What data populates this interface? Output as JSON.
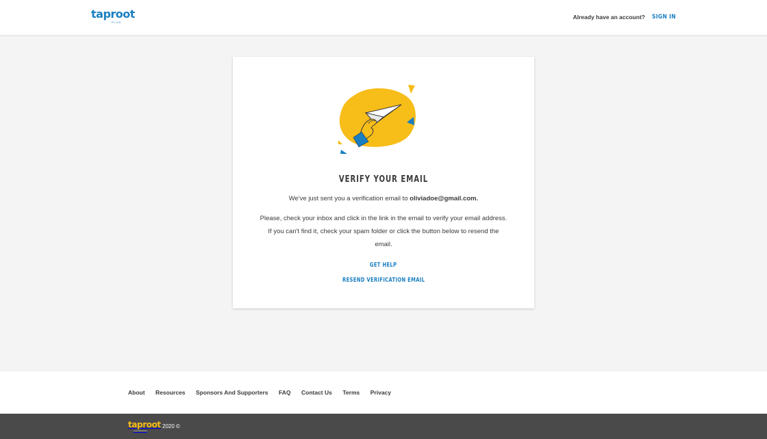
{
  "header": {
    "logo_text": "taproot",
    "logo_sub": "PLUS",
    "account_prompt": "Already have an account?",
    "sign_in_label": "SIGN IN"
  },
  "card": {
    "title": "VERIFY YOUR EMAIL",
    "sent_prefix": "We've just sent you a verification email to",
    "email": "oliviadoe@gmail.com.",
    "instructions": "Please, check your inbox and click in the link in the email to verify your email address. If you can't find it, check your spam folder or click the button below to resend the email.",
    "get_help_label": "GET HELP",
    "resend_label": "RESEND VERIFICATION EMAIL"
  },
  "footer": {
    "links": [
      "About",
      "Resources",
      "Sponsors And Supporters",
      "FAQ",
      "Contact Us",
      "Terms",
      "Privacy"
    ],
    "bottom_logo_text": "taproot",
    "bottom_logo_sub": "FOUNDATION",
    "copyright": "2020 ©"
  },
  "colors": {
    "brand_blue": "#1a7fc1",
    "brand_yellow": "#f7bd19",
    "bottom_bar": "#4a4a4a"
  },
  "icons": {
    "illustration": "hand-paper-plane-illustration"
  }
}
